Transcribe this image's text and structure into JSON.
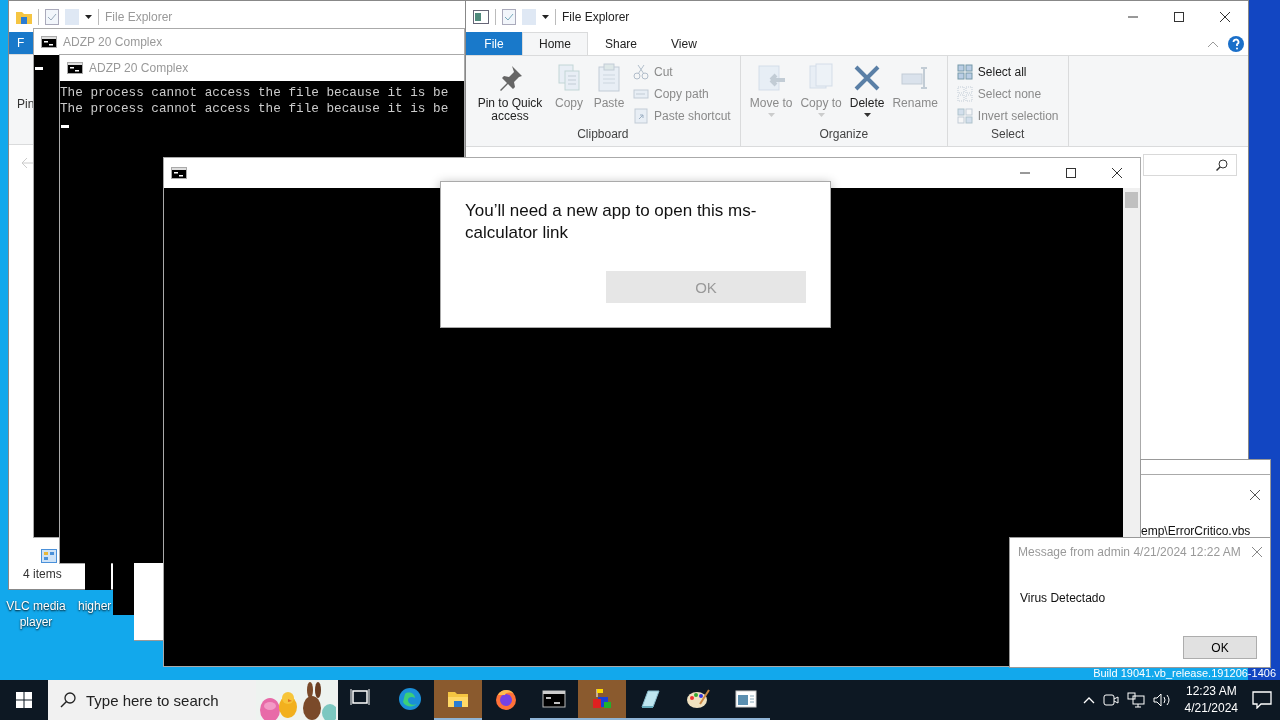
{
  "back_explorer": {
    "title": "File Explorer",
    "file_tab": "F",
    "ribbon_label": "Pin",
    "status": "4 items"
  },
  "consoles": [
    {
      "title": "ADZP 20 Complex"
    },
    {
      "title": "ADZP 20 Complex",
      "lines": [
        "The process cannot access the file because it is be",
        "The process cannot access the file because it is be"
      ]
    }
  ],
  "explorer": {
    "title": "File Explorer",
    "tabs": [
      {
        "label": "File",
        "kind": "file",
        "selected": false
      },
      {
        "label": "Home",
        "kind": "tab",
        "selected": true
      },
      {
        "label": "Share",
        "kind": "tab",
        "selected": false
      },
      {
        "label": "View",
        "kind": "tab",
        "selected": false
      }
    ],
    "groups": [
      {
        "label": "Clipboard",
        "items": [
          {
            "label": "Pin to Quick access",
            "kind": "pin",
            "disabled": false
          },
          {
            "label": "Copy",
            "kind": "copy",
            "disabled": true
          },
          {
            "label": "Paste",
            "kind": "paste",
            "disabled": true
          },
          {
            "label": "Cut",
            "kind": "cut",
            "disabled": true
          },
          {
            "label": "Copy path",
            "kind": "copypath",
            "disabled": true
          },
          {
            "label": "Paste shortcut",
            "kind": "pasteshortcut",
            "disabled": true
          }
        ]
      },
      {
        "label": "Organize",
        "items": [
          {
            "label": "Move to",
            "kind": "move",
            "disabled": true
          },
          {
            "label": "Copy to",
            "kind": "copyto",
            "disabled": true
          },
          {
            "label": "Delete",
            "kind": "delete",
            "disabled": false
          },
          {
            "label": "Rename",
            "kind": "rename",
            "disabled": true
          }
        ]
      },
      {
        "label": "Select",
        "items": [
          {
            "label": "Select all",
            "kind": "selectall",
            "disabled": false
          },
          {
            "label": "Select none",
            "kind": "selectnone",
            "disabled": true
          },
          {
            "label": "Invert selection",
            "kind": "invert",
            "disabled": true
          }
        ]
      }
    ]
  },
  "dialog": {
    "message": "You’ll need a new app to open this ms-calculator link",
    "button": {
      "label": "OK",
      "disabled": true
    }
  },
  "script_window": {
    "text": "emp\\ErrorCritico.vbs"
  },
  "message_box": {
    "title": "Message from admin 4/21/2024 12:22 AM",
    "text": "Virus Detectado",
    "button": "OK"
  },
  "desktop_icons": [
    {
      "label": "VLC media player"
    },
    {
      "label": "higher"
    }
  ],
  "build_text": "Build 19041.vb_release.191206-1406",
  "taskbar": {
    "search": {
      "placeholder": "Type here to search"
    },
    "apps": [
      {
        "kind": "taskview",
        "highlighted": false,
        "running": false
      },
      {
        "kind": "edge",
        "highlighted": false,
        "running": false
      },
      {
        "kind": "explorer",
        "highlighted": true,
        "running": true
      },
      {
        "kind": "firefox",
        "highlighted": false,
        "running": false
      },
      {
        "kind": "console",
        "highlighted": false,
        "running": true
      },
      {
        "kind": "builder",
        "highlighted": true,
        "running": true
      },
      {
        "kind": "notepad",
        "highlighted": false,
        "running": true
      },
      {
        "kind": "paint",
        "highlighted": false,
        "running": true
      },
      {
        "kind": "viewer",
        "highlighted": false,
        "running": true
      }
    ],
    "time": "12:23 AM",
    "date": "4/21/2024"
  }
}
